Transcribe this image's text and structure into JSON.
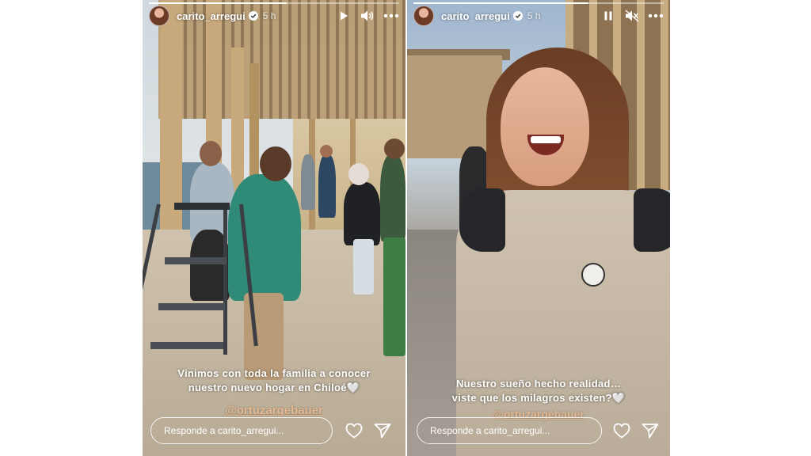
{
  "stories": [
    {
      "username": "carito_arregui",
      "time": "5 h",
      "progress": 0.55,
      "playback_icon": "play-icon",
      "sound_icon": "volume-on-icon",
      "caption_lines": [
        "Vinimos con toda la familia a conocer",
        "nuestro nuevo hogar en Chiloé🤍"
      ],
      "mention": "@ortuzargebauer",
      "reply_placeholder": "Responde a carito_arregui..."
    },
    {
      "username": "carito_arregui",
      "time": "5 h",
      "progress": 0.7,
      "playback_icon": "pause-icon",
      "sound_icon": "volume-muted-icon",
      "caption_lines": [
        "Nuestro sueño hecho realidad…",
        "viste que los milagros existen?🤍"
      ],
      "mention": "@ortuzargebauer",
      "reply_placeholder": "Responde a carito_arregui..."
    }
  ],
  "colors": {
    "text": "#ffffff",
    "verified_badge": "#ffffff",
    "mention": "#e4b890"
  }
}
